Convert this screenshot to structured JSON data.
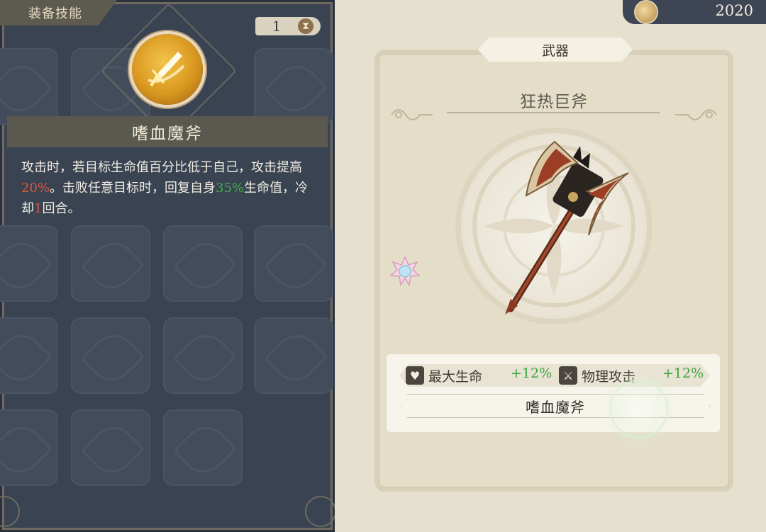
{
  "left_panel": {
    "tab_label": "装备技能",
    "count": "1",
    "count_icon": "hourglass-icon",
    "skill_icon": "dagger-skill-icon",
    "skill_name": "嗜血魔斧",
    "description": {
      "part1": "攻击时，若目标生命值百分比低于自己，攻击提高",
      "value1": "20%",
      "part2": "。击败任意目标时，回复自身",
      "value2": "35%",
      "part3": "生命值，冷却",
      "value3": "1",
      "part4": "回合。"
    }
  },
  "currency": {
    "icon": "coin-icon",
    "value": "2020"
  },
  "weapon": {
    "category": "武器",
    "name": "狂热巨斧",
    "image": "great-axe-icon",
    "badge_icon": "star-badge-icon",
    "stats": [
      {
        "icon": "heart-icon",
        "label": "最大生命",
        "value": "+12%"
      },
      {
        "icon": "sword-icon",
        "label": "物理攻击",
        "value": "+12%"
      }
    ],
    "skill_label": "嗜血魔斧"
  },
  "colors": {
    "panel_dark": "#3a4352",
    "highlight_red": "#e0553b",
    "highlight_green": "#3fb24a",
    "stat_green": "#3ba33f"
  }
}
